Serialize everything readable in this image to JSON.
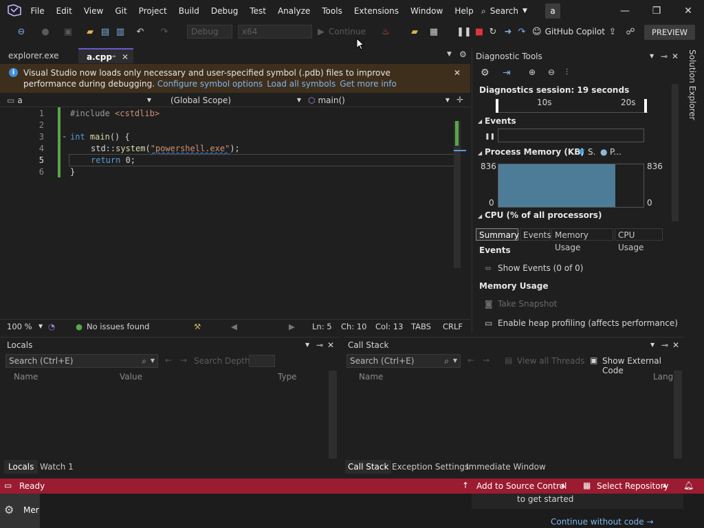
{
  "menubar": {
    "items": [
      "File",
      "Edit",
      "View",
      "Git",
      "Project",
      "Build",
      "Debug",
      "Test",
      "Analyze",
      "Tools",
      "Extensions",
      "Window",
      "Help"
    ],
    "search_label": "Search",
    "profile_initial": "a"
  },
  "toolbar": {
    "config_combo": "Debug",
    "platform_combo": "x64",
    "continue_label": "Continue",
    "copilot_label": "GitHub Copilot",
    "preview_label": "PREVIEW"
  },
  "doc_tabs": {
    "tab1": "explorer.exe",
    "tab2": "a.cpp"
  },
  "infobar": {
    "message": "Visual Studio now loads only necessary and user-specified symbol (.pdb) files to improve performance during debugging.",
    "link1": "Configure symbol options",
    "link2": "Load all symbols",
    "link3": "Get more info"
  },
  "navbar": {
    "project": "a",
    "scope": "(Global Scope)",
    "member": "main()"
  },
  "code": {
    "line_numbers": [
      "1",
      "2",
      "3",
      "4",
      "5",
      "6"
    ],
    "l1_pp": "#include ",
    "l1_inc": "<cstdlib>",
    "l3_kw": "int",
    "l3_fn": "main",
    "l3_rest": "() {",
    "l4_ns": "std::",
    "l4_fn": "system",
    "l4_open": "(",
    "l4_str": "\"powershell.exe\"",
    "l4_close": ");",
    "l5_kw": "return",
    "l5_rest": " 0;",
    "l6": "}"
  },
  "editor_status": {
    "zoom": "100 %",
    "issues": "No issues found",
    "line": "Ln: 5",
    "col": "Ch: 10",
    "c": "Col: 13",
    "tabs": "TABS",
    "eol": "CRLF"
  },
  "diagnostics": {
    "title": "Diagnostic Tools",
    "session": "Diagnostics session: 19 seconds",
    "tick1": "10s",
    "tick2": "20s",
    "events_label": "Events",
    "memory_label": "Process Memory (KB)",
    "legend1": "S.",
    "legend2": "P...",
    "mem_max": "836",
    "mem_min": "0",
    "mem_max_r": "836",
    "mem_min_r": "0",
    "cpu_label": "CPU (% of all processors)",
    "tabs": [
      "Summary",
      "Events",
      "Memory Usage",
      "CPU Usage"
    ],
    "sec_events": "Events",
    "show_events": "Show Events (0 of 0)",
    "sec_memory": "Memory Usage",
    "take_snapshot": "Take Snapshot",
    "heap_profiling": "Enable heap profiling (affects performance)"
  },
  "sidebar": {
    "label": "Solution Explorer"
  },
  "locals": {
    "title": "Locals",
    "search_placeholder": "Search (Ctrl+E)",
    "search_depth": "Search Depth:",
    "col_name": "Name",
    "col_value": "Value",
    "col_type": "Type",
    "tab1": "Locals",
    "tab2": "Watch 1"
  },
  "callstack": {
    "title": "Call Stack",
    "search_placeholder": "Search (Ctrl+E)",
    "view_threads": "View all Threads",
    "show_external": "Show External Code",
    "col_name": "Name",
    "col_lang": "Lang",
    "tab1": "Call Stack",
    "tab2": "Exception Settings",
    "tab3": "Immediate Window"
  },
  "statusbar": {
    "ready": "Ready",
    "source_control": "Add to Source Control",
    "select_repo": "Select Repository"
  },
  "taskbar": {
    "app_label": "Mer",
    "get_started": "to get started",
    "continue_without_code": "Continue without code →"
  },
  "colors": {
    "accent": "#6e56cf",
    "status": "#9b1b30",
    "info": "#3e2f1c"
  }
}
